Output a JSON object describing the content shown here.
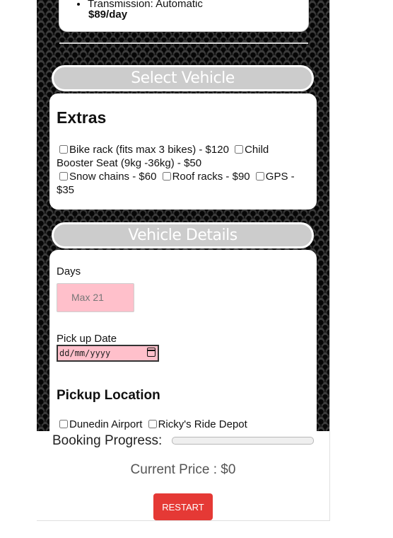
{
  "vehicle_card": {
    "spec": "Transmission: Automatic",
    "price": "$89/day"
  },
  "select_vehicle": {
    "label": "Select Vehicle"
  },
  "extras": {
    "title": "Extras",
    "options": [
      {
        "label": "Bike rack (fits max 3 bikes) - $120",
        "checked": false
      },
      {
        "label": "Child Booster Seat (9kg -36kg) - $50",
        "checked": false
      },
      {
        "label": "Snow chains - $60",
        "checked": false
      },
      {
        "label": "Roof racks - $90",
        "checked": false
      },
      {
        "label": "GPS - $35",
        "checked": false
      }
    ]
  },
  "vehicle_details": {
    "label": "Vehicle Details",
    "days_label": "Days",
    "days_placeholder": "Max 21",
    "pickup_date_label": "Pick up Date",
    "pickup_date_placeholder": "dd/mm/yyyy",
    "pickup_location_title": "Pickup Location",
    "locations": [
      {
        "label": "Dunedin Airport",
        "checked": false
      },
      {
        "label": "Ricky's Ride Depot",
        "checked": false
      }
    ]
  },
  "footer": {
    "progress_label": "Booking Progress:",
    "progress_value": 0,
    "current_price": "Current Price : $0",
    "restart_label": "RESTART"
  },
  "colors": {
    "pill_bg": "#cccccc",
    "input_bg": "#ffc0cb",
    "restart_bg": "#e53935"
  }
}
